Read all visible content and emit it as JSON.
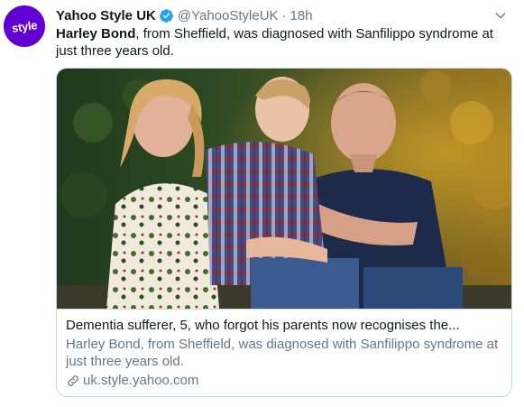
{
  "account": {
    "avatar_text": "style",
    "display_name": "Yahoo Style UK",
    "handle": "@YahooStyleUK",
    "separator": "·",
    "time": "18h"
  },
  "tweet": {
    "mention": "Harley Bond",
    "text_rest": ", from Sheffield, was diagnosed with Sanfilippo syndrome at just three years old."
  },
  "card": {
    "title": "Dementia sufferer, 5, who forgot his parents now recognises the...",
    "description": "Harley Bond, from Sheffield, was diagnosed with Sanfilippo syndrome at just three years old.",
    "domain": "uk.style.yahoo.com"
  },
  "colors": {
    "brand": "#6001d2",
    "verified": "#1da1f2",
    "muted": "#657786",
    "text": "#14171a",
    "border": "#ccd6dd"
  },
  "icons": [
    "verified-badge-icon",
    "chevron-down-icon",
    "link-icon"
  ]
}
